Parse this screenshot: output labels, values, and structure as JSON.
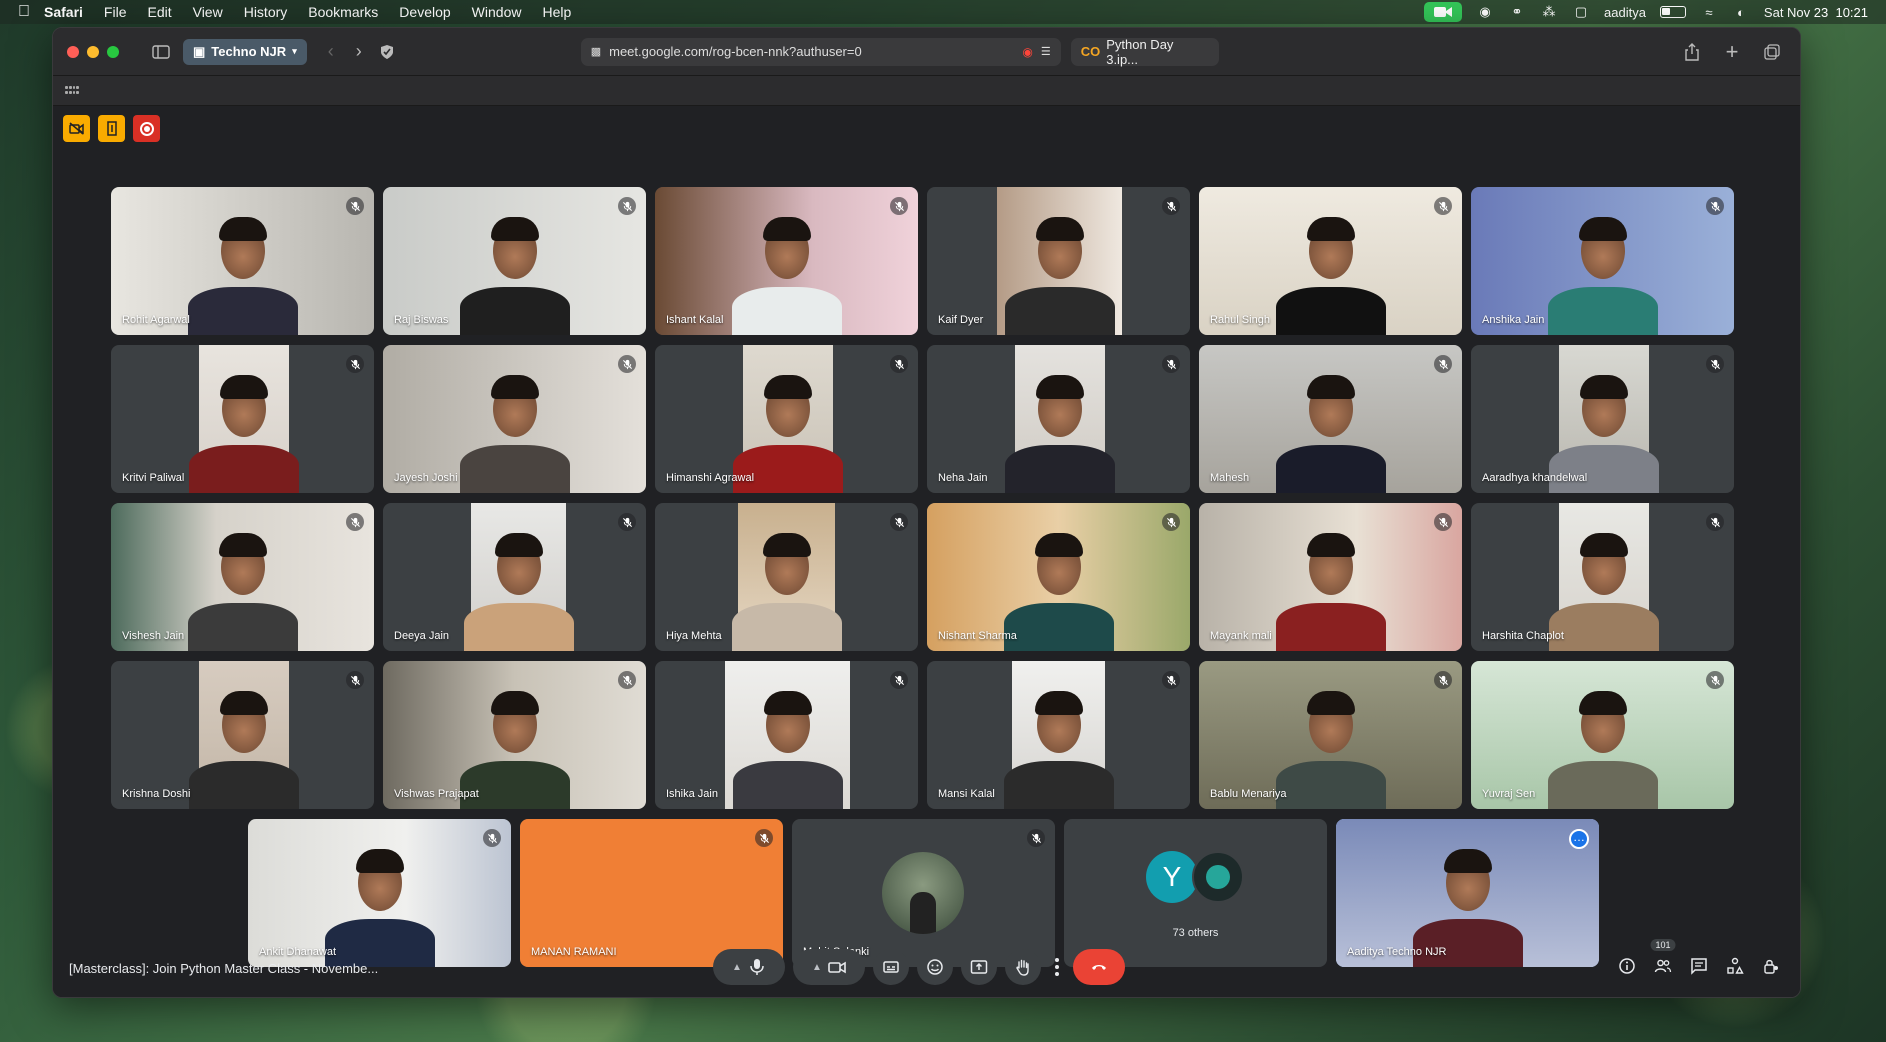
{
  "menubar": {
    "app": "Safari",
    "items": [
      "File",
      "Edit",
      "View",
      "History",
      "Bookmarks",
      "Develop",
      "Window",
      "Help"
    ],
    "user": "aaditya",
    "datetime": "Sat Nov 23  10:21"
  },
  "browser": {
    "tab_group": "Techno NJR",
    "url": "meet.google.com/rog-bcen-nnk?authuser=0",
    "other_tab": "Python Day 3.ip..."
  },
  "meet": {
    "participants": [
      {
        "name": "Rohit Agarwal"
      },
      {
        "name": "Raj Biswas"
      },
      {
        "name": "Ishant Kalal"
      },
      {
        "name": "Kaif Dyer"
      },
      {
        "name": "Rahul Singh"
      },
      {
        "name": "Anshika Jain"
      },
      {
        "name": "Kritvi Paliwal"
      },
      {
        "name": "Jayesh Joshi"
      },
      {
        "name": "Himanshi Agrawal"
      },
      {
        "name": "Neha Jain"
      },
      {
        "name": "Mahesh"
      },
      {
        "name": "Aaradhya khandelwal"
      },
      {
        "name": "Vishesh Jain"
      },
      {
        "name": "Deeya Jain"
      },
      {
        "name": "Hiya Mehta"
      },
      {
        "name": "Nishant Sharma"
      },
      {
        "name": "Mayank mali"
      },
      {
        "name": "Harshita Chaplot"
      },
      {
        "name": "Krishna Doshi"
      },
      {
        "name": "Vishwas Prajapat"
      },
      {
        "name": "Ishika Jain"
      },
      {
        "name": "Mansi Kalal"
      },
      {
        "name": "Bablu Menariya"
      },
      {
        "name": "Yuvraj Sen"
      },
      {
        "name": "Ankit Dhanawat"
      },
      {
        "name": "MANAN RAMANI"
      },
      {
        "name": "Mohit Solanki"
      },
      {
        "name": "73 others",
        "avatar_letter": "Y"
      },
      {
        "name": "Aaditya Techno NJR"
      }
    ],
    "meeting_title": "[Masterclass]: Join Python Master Class - Novembe...",
    "people_count": "101"
  }
}
